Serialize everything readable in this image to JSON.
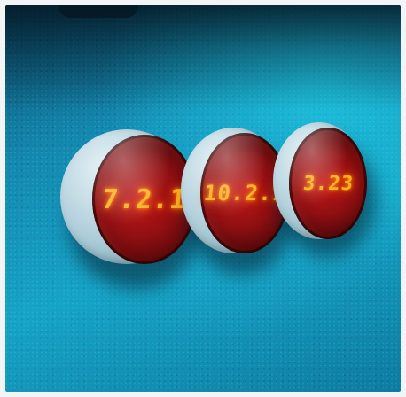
{
  "scene": {
    "description_colors": {
      "wall": "#17a3c6",
      "lens_red": "#8f0f12",
      "digit_glow": "#ffb020"
    }
  },
  "indicators": [
    {
      "reading": "7.2.1"
    },
    {
      "reading": "10.2.1"
    },
    {
      "reading": "3.23"
    }
  ]
}
